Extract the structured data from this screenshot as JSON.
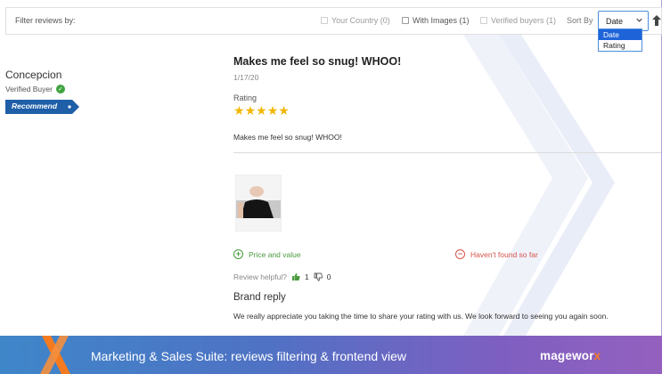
{
  "filters": {
    "label": "Filter reviews by:",
    "your_country": "Your Country (0)",
    "with_images": "With Images (1)",
    "verified_buyers": "Verified buyers (1)",
    "sort_by_label": "Sort By",
    "sort_selected": "Date",
    "sort_options": [
      "Date",
      "Rating"
    ],
    "sort_direction_icon": "arrow-up-icon"
  },
  "author": {
    "name": "Concepcion",
    "verified_label": "Verified Buyer",
    "recommend_label": "Recommend"
  },
  "review": {
    "title": "Makes me feel so snug! WHOO!",
    "date": "1/17/20",
    "rating_label": "Rating",
    "rating": 5,
    "rating_max": 5,
    "stars": [
      "★",
      "★",
      "★",
      "★",
      "★"
    ],
    "body": "Makes me feel so snug! WHOO!",
    "pros": "Price and value",
    "cons": "Haven't found so far",
    "helpful_label": "Review helpful?",
    "helpful_yes": "1",
    "helpful_no": "0"
  },
  "brand_reply": {
    "title": "Brand reply",
    "text": "We really appreciate you taking the time to share your rating with us. We look forward to seeing you again soon."
  },
  "banner": {
    "text": "Marketing & Sales Suite: reviews filtering & frontend view",
    "brand_main": "magewor",
    "brand_x": "x"
  },
  "colors": {
    "accent_blue": "#4a8ddb",
    "star": "#f2b705",
    "pros_green": "#4a9a3e",
    "cons_red": "#d6534a",
    "recommend_badge": "#1e5fa8",
    "brand_orange": "#f47b20"
  }
}
